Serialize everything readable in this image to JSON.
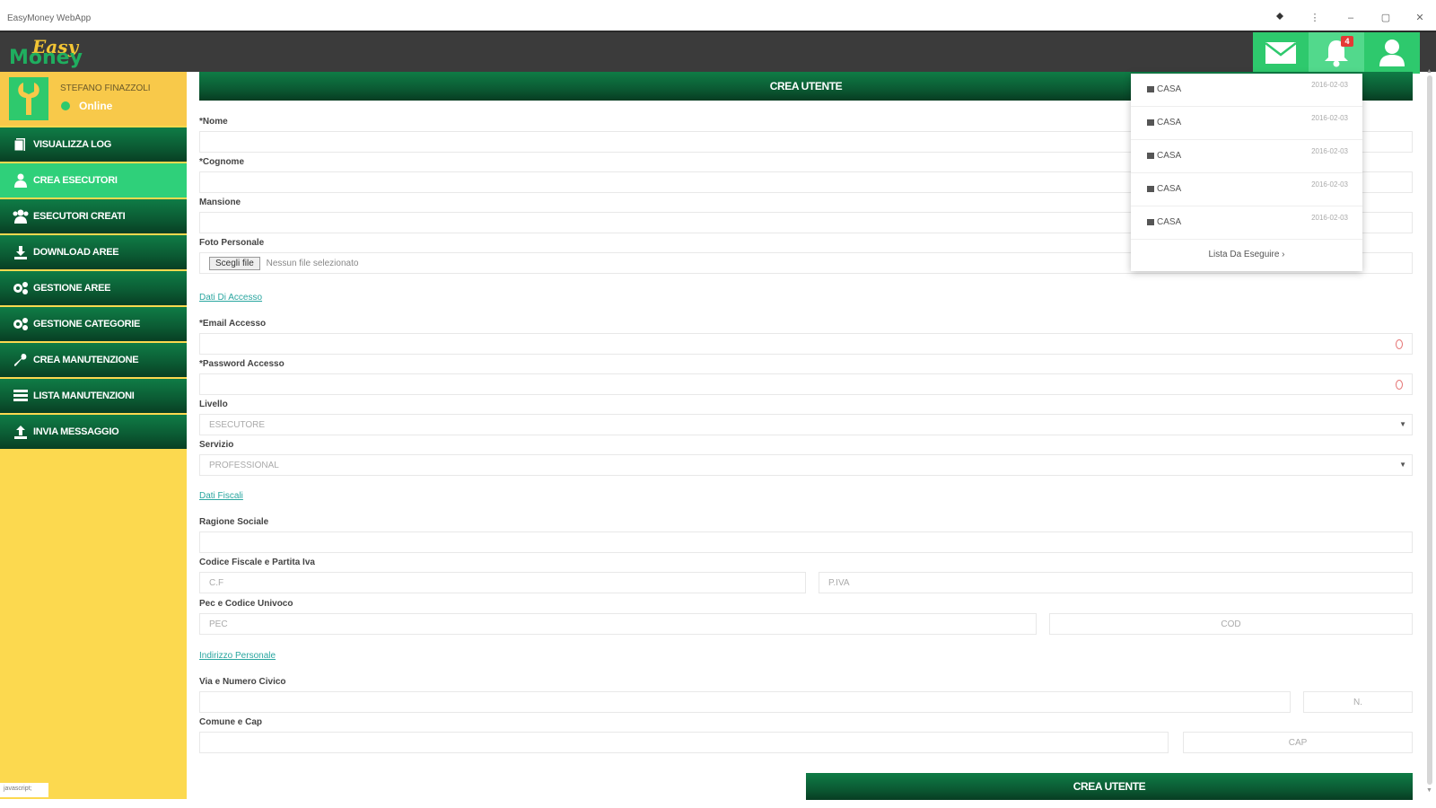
{
  "window": {
    "title": "EasyMoney WebApp",
    "controls": [
      "–",
      "▢",
      "✕"
    ]
  },
  "header": {
    "logo_top": "Easy",
    "logo_bottom": "Money",
    "notification_count": "4",
    "accent": "#2ec96d",
    "bg": "#3b3b3b"
  },
  "sidebar": {
    "user_name": "STEFANO FINAZZOLI",
    "user_status": "Online",
    "items": [
      {
        "label": "VISUALIZZA LOG",
        "icon": "file-icon"
      },
      {
        "label": "CREA ESECUTORI",
        "icon": "user-icon"
      },
      {
        "label": "ESECUTORI CREATI",
        "icon": "users-icon"
      },
      {
        "label": "DOWNLOAD AREE",
        "icon": "download-icon"
      },
      {
        "label": "GESTIONE AREE",
        "icon": "gears-icon"
      },
      {
        "label": "GESTIONE CATEGORIE",
        "icon": "gears-icon"
      },
      {
        "label": "CREA MANUTENZIONE",
        "icon": "wrench-icon"
      },
      {
        "label": "LISTA MANUTENZIONI",
        "icon": "list-icon"
      },
      {
        "label": "INVIA MESSAGGIO",
        "icon": "upload-icon"
      }
    ],
    "footer": "javascript;"
  },
  "form": {
    "title": "CREA UTENTE",
    "nome_label": "*Nome",
    "cognome_label": "*Cognome",
    "mansione_label": "Mansione",
    "foto_label": "Foto Personale",
    "file_button": "Scegli file",
    "file_status": "Nessun file selezionato",
    "link_accesso": "Dati Di Accesso",
    "email_label": "*Email Accesso",
    "password_label": "*Password Accesso",
    "livello_label": "Livello",
    "livello_value": "ESECUTORE",
    "servizio_label": "Servizio",
    "servizio_value": "PROFESSIONAL",
    "link_fiscali": "Dati Fiscali",
    "ragione_label": "Ragione Sociale",
    "cf_piva_label": "Codice Fiscale e Partita Iva",
    "cf_placeholder": "C.F",
    "piva_placeholder": "P.IVA",
    "pec_label": "Pec e Codice Univoco",
    "pec_placeholder": "PEC",
    "cod_placeholder": "COD",
    "link_indirizzo": "Indirizzo Personale",
    "via_label": "Via e Numero Civico",
    "civico_placeholder": "N.",
    "comune_label": "Comune e Cap",
    "cap_placeholder": "CAP",
    "submit": "CREA UTENTE"
  },
  "notifications": {
    "items": [
      {
        "title": "CASA",
        "date": "2016-02-03"
      },
      {
        "title": "CASA",
        "date": "2016-02-03"
      },
      {
        "title": "CASA",
        "date": "2016-02-03"
      },
      {
        "title": "CASA",
        "date": "2016-02-03"
      },
      {
        "title": "CASA",
        "date": "2016-02-03"
      }
    ],
    "footer": "Lista Da Eseguire ›"
  }
}
